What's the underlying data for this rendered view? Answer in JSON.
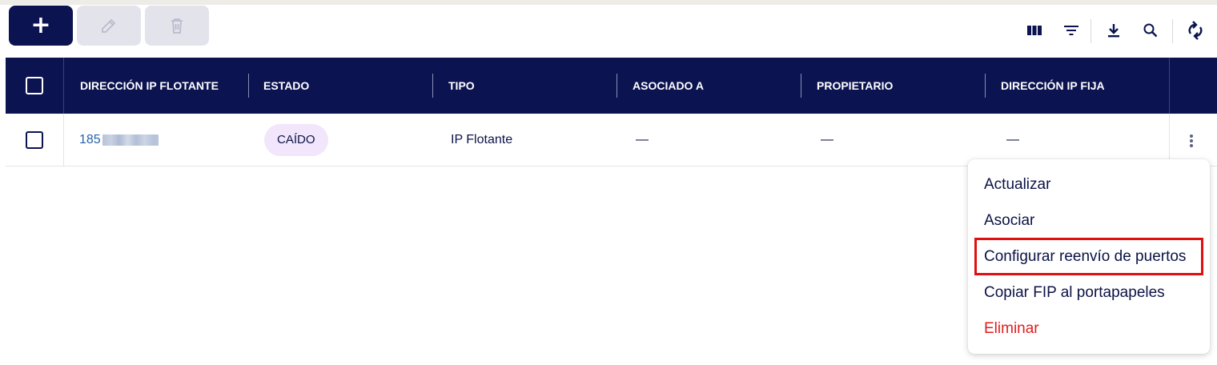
{
  "toolbar": {
    "add_label": "+",
    "icons": [
      "columns-icon",
      "filter-icon",
      "download-icon",
      "search-icon",
      "refresh-icon"
    ]
  },
  "table": {
    "headers": [
      "DIRECCIÓN IP FLOTANTE",
      "ESTADO",
      "TIPO",
      "ASOCIADO A",
      "PROPIETARIO",
      "DIRECCIÓN IP FIJA"
    ],
    "rows": [
      {
        "ip_visible": "185",
        "estado": "CAÍDO",
        "tipo": "IP Flotante",
        "asociado": "—",
        "propietario": "—",
        "ip_fija": "—"
      }
    ]
  },
  "context_menu": {
    "items": [
      "Actualizar",
      "Asociar",
      "Configurar reenvío de puertos",
      "Copiar FIP al portapapeles",
      "Eliminar"
    ]
  },
  "colors": {
    "header_bg": "#0b1351",
    "badge_bg": "#f1e6fb",
    "danger": "#e11d1d",
    "highlight_border": "#e01010",
    "link": "#2763a8"
  }
}
